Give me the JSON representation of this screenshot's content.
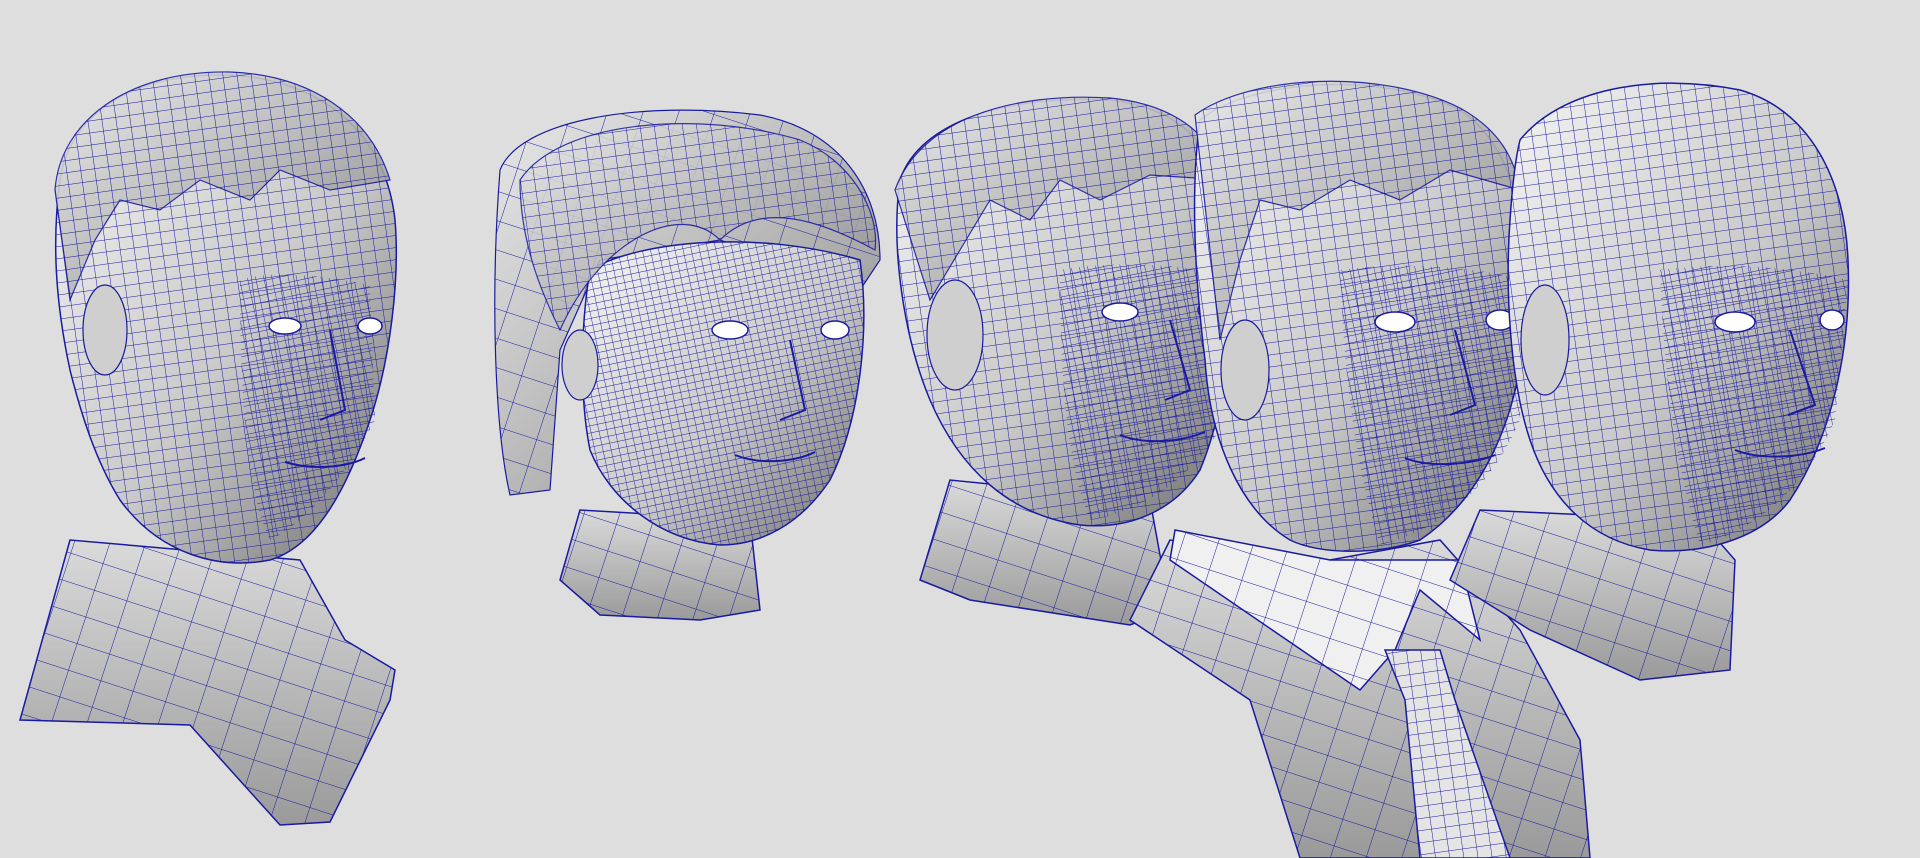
{
  "viewport": {
    "background": "#dedede",
    "wire_color": "#1a1aa0",
    "shade_light": "#f4f4f4",
    "shade_mid": "#b9b9b9",
    "shade_dark": "#6e6e6e"
  },
  "models": [
    {
      "kind": "head-with-shoulders",
      "facing": "right",
      "hair": "short"
    },
    {
      "kind": "head",
      "facing": "right",
      "hair": "bob"
    },
    {
      "kind": "head-with-neck",
      "facing": "right",
      "hair": "short"
    },
    {
      "kind": "head-with-collar-and-tie",
      "facing": "right",
      "hair": "short"
    },
    {
      "kind": "head",
      "facing": "right",
      "hair": "bald"
    }
  ]
}
